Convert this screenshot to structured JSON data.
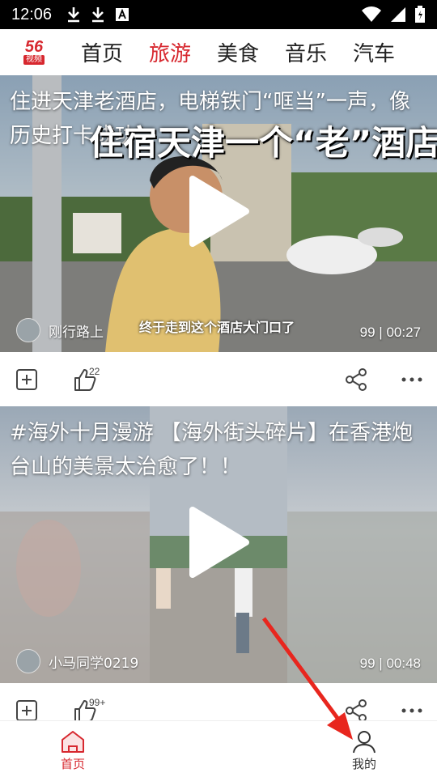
{
  "status_bar": {
    "time": "12:06",
    "icons_left": [
      "download-icon",
      "download-icon",
      "keyboard-a-icon"
    ],
    "icons_right": [
      "wifi-icon",
      "signal-icon",
      "battery-icon"
    ]
  },
  "logo": {
    "number": "56",
    "subtitle": "视频"
  },
  "nav_tabs": [
    {
      "label": "首页",
      "active": false
    },
    {
      "label": "旅游",
      "active": true
    },
    {
      "label": "美食",
      "active": false
    },
    {
      "label": "音乐",
      "active": false
    },
    {
      "label": "汽车",
      "active": false
    }
  ],
  "feed": [
    {
      "title": "住进天津老酒店，电梯铁门“哐当”一声，像历史打卡成功",
      "author": "刚行路上",
      "meta": "99 | 00:27",
      "likes": "22",
      "overlay_title": "住宿天津一个“老”酒店",
      "caption": "终于走到这个酒店大门口了"
    },
    {
      "title": "#海外十月漫游 【海外街头碎片】在香港炮台山的美景太治愈了！！",
      "author": "小马同学0219",
      "meta": "99 | 00:48",
      "likes": "99+"
    }
  ],
  "bottom_nav": [
    {
      "label": "首页",
      "icon": "home-icon",
      "active": true
    },
    {
      "label": "我的",
      "icon": "profile-icon",
      "active": false
    }
  ],
  "colors": {
    "accent": "#d7282f"
  }
}
